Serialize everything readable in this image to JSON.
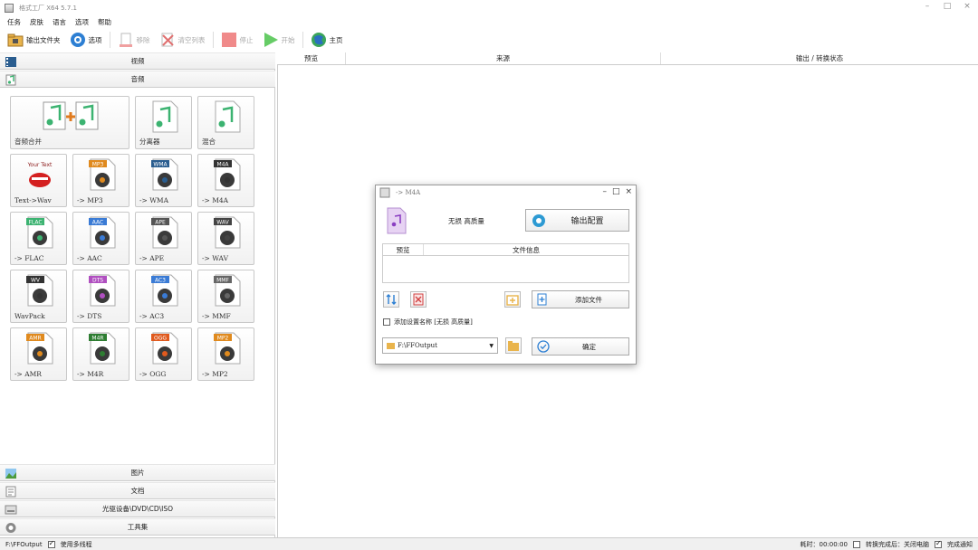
{
  "window": {
    "title": "格式工厂 X64 5.7.1",
    "controls": [
      "–",
      "□",
      "×"
    ]
  },
  "menu": [
    "任务",
    "皮肤",
    "语言",
    "选项",
    "帮助"
  ],
  "toolbar": {
    "output_folder": "输出文件夹",
    "options": "选项",
    "remove": "移除",
    "clear_list": "清空列表",
    "stop": "停止",
    "start": "开始",
    "home": "主页"
  },
  "categories": {
    "video": "视频",
    "audio": "音频",
    "picture": "图片",
    "document": "文档",
    "disc": "光驱设备\\DVD\\CD\\ISO",
    "tools": "工具集"
  },
  "tiles": [
    {
      "label": "音频合并",
      "badge": "",
      "icon": "audio-merge-icon",
      "color": "#3cb371"
    },
    {
      "label": "分离器",
      "badge": "",
      "icon": "splitter-icon",
      "color": "#3cb371"
    },
    {
      "label": "混合",
      "badge": "",
      "icon": "mix-icon",
      "color": "#3cb371"
    },
    {
      "label": "Text->Wav",
      "badge": "Your Text",
      "icon": "text-to-wav-icon",
      "color": "#d42020"
    },
    {
      "label": "-> MP3",
      "badge": "MP3",
      "icon": "mp3-icon",
      "color": "#e08a1e"
    },
    {
      "label": "-> WMA",
      "badge": "WMA",
      "icon": "wma-icon",
      "color": "#2a5d8f"
    },
    {
      "label": "-> M4A",
      "badge": "M4A",
      "icon": "m4a-icon",
      "color": "#333333"
    },
    {
      "label": "-> FLAC",
      "badge": "FLAC",
      "icon": "flac-icon",
      "color": "#3cb371"
    },
    {
      "label": "-> AAC",
      "badge": "AAC",
      "icon": "aac-icon",
      "color": "#3a7bd5"
    },
    {
      "label": "-> APE",
      "badge": "APE",
      "icon": "ape-icon",
      "color": "#555555"
    },
    {
      "label": "-> WAV",
      "badge": "WAV",
      "icon": "wav-icon",
      "color": "#444444"
    },
    {
      "label": "WavPack",
      "badge": "WV",
      "icon": "wavpack-icon",
      "color": "#333333"
    },
    {
      "label": "-> DTS",
      "badge": "DTS",
      "icon": "dts-icon",
      "color": "#b04fc0"
    },
    {
      "label": "-> AC3",
      "badge": "AC3",
      "icon": "ac3-icon",
      "color": "#3a7bd5"
    },
    {
      "label": "-> MMF",
      "badge": "MMF",
      "icon": "mmf-icon",
      "color": "#666666"
    },
    {
      "label": "-> AMR",
      "badge": "AMR",
      "icon": "amr-icon",
      "color": "#e08a1e"
    },
    {
      "label": "-> M4R",
      "badge": "M4R",
      "icon": "m4r-icon",
      "color": "#2e7d32"
    },
    {
      "label": "-> OGG",
      "badge": "OGG",
      "icon": "ogg-icon",
      "color": "#e05a1e"
    },
    {
      "label": "-> MP2",
      "badge": "MP2",
      "icon": "mp2-icon",
      "color": "#e08a1e"
    }
  ],
  "table": {
    "col_preview": "预览",
    "col_source": "来源",
    "col_output": "输出 / 转换状态"
  },
  "dialog": {
    "title": "-> M4A",
    "quality": "无损 高质量",
    "config_button": "输出配置",
    "col_preview": "预览",
    "col_fileinfo": "文件信息",
    "add_file": "添加文件",
    "add_setting_name": "添加设置名称 [无损 高质量]",
    "output_path": "F:\\FFOutput",
    "ok": "确定"
  },
  "statusbar": {
    "path": "F:\\FFOutput",
    "multithread": "使用多线程",
    "elapsed": "耗时：00:00:00",
    "after_convert": "转换完成后：关闭电脑",
    "notify": "完成通知"
  },
  "colors": {
    "accent_green": "#3cb371",
    "accent_blue": "#2d7fd3",
    "stop_red": "#f08a8a",
    "start_green": "#66cc66",
    "folder_yellow": "#e9b44c"
  }
}
